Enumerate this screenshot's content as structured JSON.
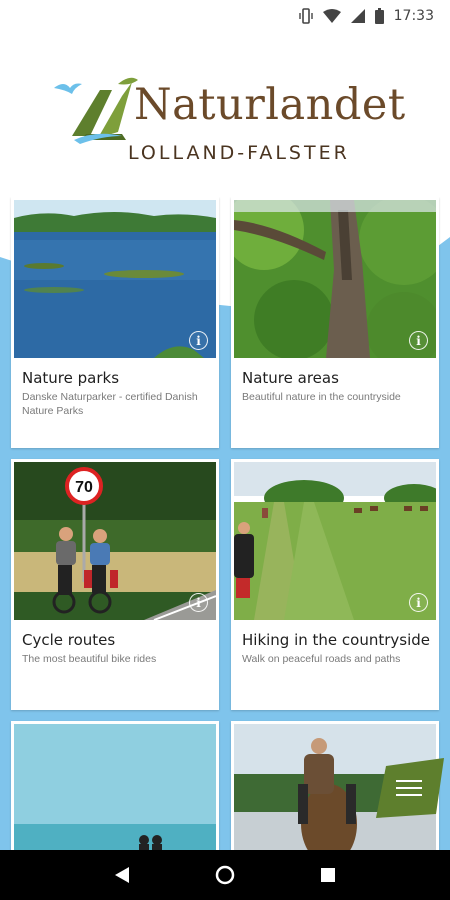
{
  "status_bar": {
    "time": "17:33",
    "icons": [
      "vibrate-icon",
      "wifi-icon",
      "signal-icon",
      "battery-icon"
    ]
  },
  "logo": {
    "title": "Naturlandet",
    "subtitle": "LOLLAND-FALSTER"
  },
  "cards": [
    {
      "title": "Nature parks",
      "description": "Danske Naturparker - certified Danish Nature Parks",
      "image": "lake"
    },
    {
      "title": "Nature areas",
      "description": "Beautiful nature in the countryside",
      "image": "tree"
    },
    {
      "title": "Cycle routes",
      "description": "The most beautiful bike rides",
      "image": "cyclists"
    },
    {
      "title": "Hiking in the countryside",
      "description": "Walk on peaceful roads and paths",
      "image": "meadow"
    },
    {
      "title": "",
      "description": "",
      "image": "beach"
    },
    {
      "title": "",
      "description": "",
      "image": "horse"
    }
  ],
  "sign_speed": "70",
  "menu_button": {
    "icon": "menu-icon"
  },
  "nav_bar": {
    "icons": [
      "back-icon",
      "home-icon",
      "recents-icon"
    ]
  },
  "colors": {
    "accent_blue": "#7fc4ec",
    "brand_green": "#5e7f2d",
    "brand_brown": "#6b4a2a"
  }
}
